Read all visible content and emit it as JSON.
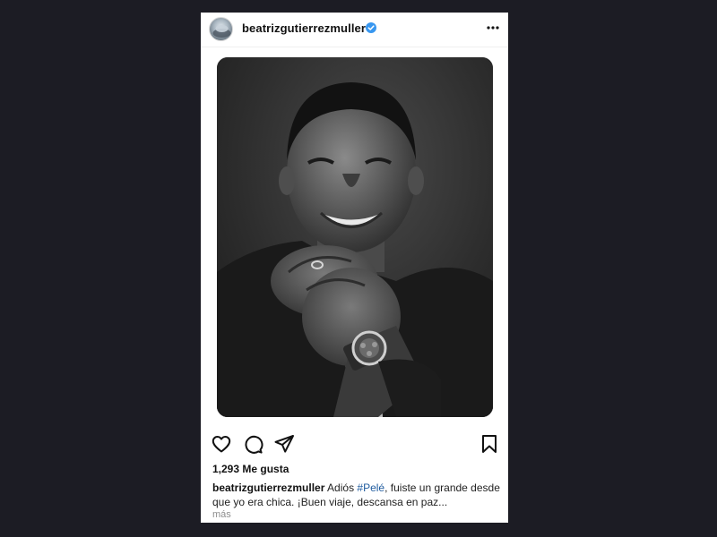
{
  "post": {
    "username": "beatrizgutierrezmuller",
    "verified": true,
    "more_icon": "more-horizontal-icon",
    "likes_text": "1,293 Me gusta",
    "caption": {
      "username": "beatrizgutierrezmuller",
      "text_before": " Adiós ",
      "hashtag": "#Pelé",
      "text_after": ", fuiste un grande desde que yo era chica. ¡Buen viaje, descansa en paz..."
    },
    "more_label": "más",
    "actions": [
      "heart-icon",
      "comment-icon",
      "share-icon",
      "bookmark-icon"
    ]
  },
  "colors": {
    "background": "#1c1c24",
    "card": "#ffffff",
    "verified": "#3897f0",
    "hashtag": "#1d5a9e"
  }
}
